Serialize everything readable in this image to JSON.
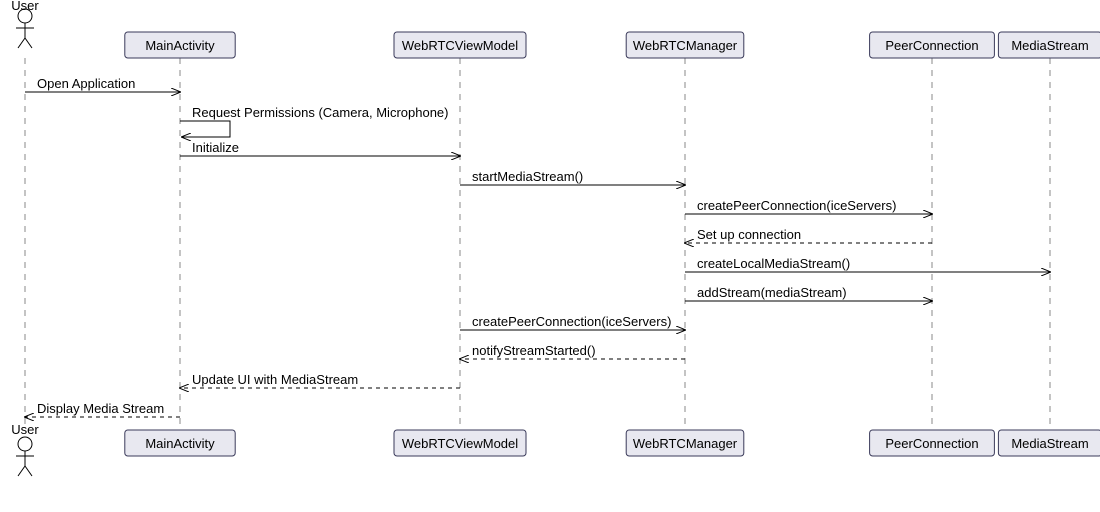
{
  "diagram": {
    "type": "sequence",
    "actors": [
      {
        "id": "user",
        "label": "User",
        "kind": "actor"
      },
      {
        "id": "main",
        "label": "MainActivity",
        "kind": "participant"
      },
      {
        "id": "vm",
        "label": "WebRTCViewModel",
        "kind": "participant"
      },
      {
        "id": "mgr",
        "label": "WebRTCManager",
        "kind": "participant"
      },
      {
        "id": "pc",
        "label": "PeerConnection",
        "kind": "participant"
      },
      {
        "id": "ms",
        "label": "MediaStream",
        "kind": "participant"
      }
    ],
    "messages": [
      {
        "from": "user",
        "to": "main",
        "label": "Open Application",
        "style": "solid"
      },
      {
        "from": "main",
        "to": "main",
        "label": "Request Permissions (Camera, Microphone)",
        "style": "self"
      },
      {
        "from": "main",
        "to": "vm",
        "label": "Initialize",
        "style": "solid"
      },
      {
        "from": "vm",
        "to": "mgr",
        "label": "startMediaStream()",
        "style": "solid"
      },
      {
        "from": "mgr",
        "to": "pc",
        "label": "createPeerConnection(iceServers)",
        "style": "solid"
      },
      {
        "from": "pc",
        "to": "mgr",
        "label": "Set up connection",
        "style": "dashed"
      },
      {
        "from": "mgr",
        "to": "ms",
        "label": "createLocalMediaStream()",
        "style": "solid"
      },
      {
        "from": "mgr",
        "to": "pc",
        "label": "addStream(mediaStream)",
        "style": "solid"
      },
      {
        "from": "vm",
        "to": "mgr",
        "label": "createPeerConnection(iceServers)",
        "style": "solid"
      },
      {
        "from": "mgr",
        "to": "vm",
        "label": "notifyStreamStarted()",
        "style": "dashed"
      },
      {
        "from": "vm",
        "to": "main",
        "label": "Update UI with MediaStream",
        "style": "dashed"
      },
      {
        "from": "main",
        "to": "user",
        "label": "Display Media Stream",
        "style": "dashed"
      }
    ]
  }
}
